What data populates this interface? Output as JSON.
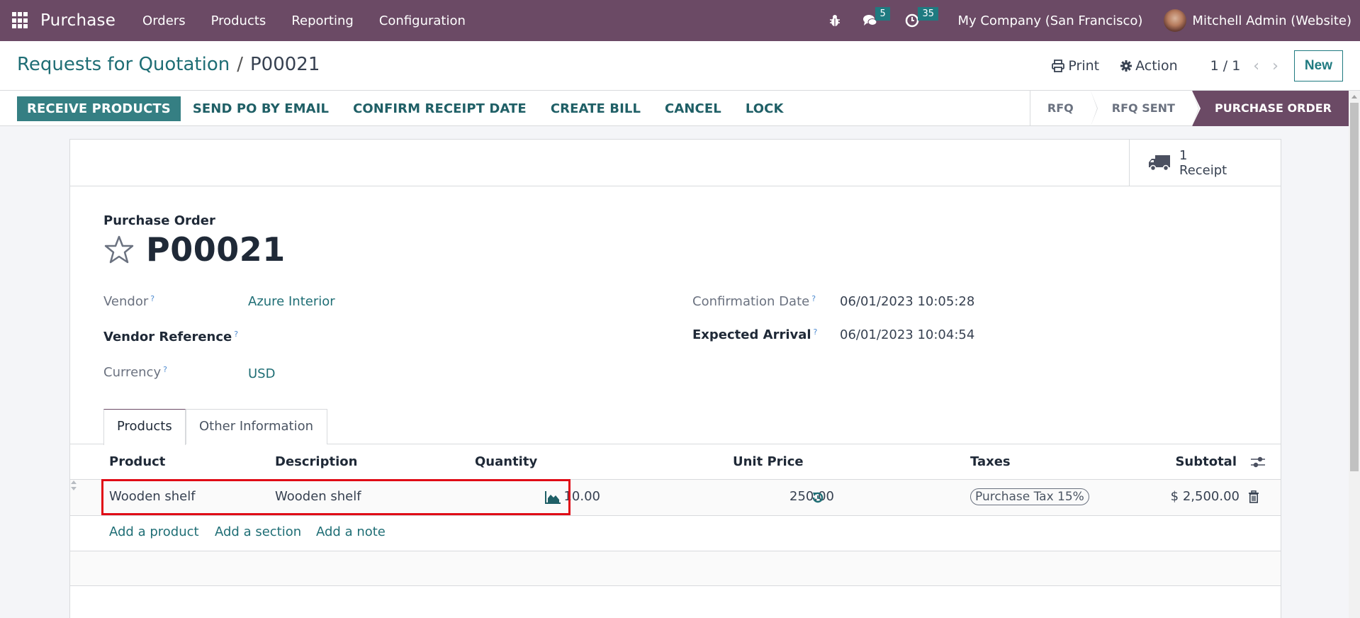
{
  "navbar": {
    "app_name": "Purchase",
    "menu": [
      "Orders",
      "Products",
      "Reporting",
      "Configuration"
    ],
    "messages_count": "5",
    "activities_count": "35",
    "company": "My Company (San Francisco)",
    "user": "Mitchell Admin (Website)",
    "bg_color": "#6b4a65"
  },
  "breadcrumb": {
    "parent": "Requests for Quotation",
    "separator": "/",
    "current": "P00021"
  },
  "control_panel": {
    "print_label": "Print",
    "action_label": "Action",
    "pager": "1 / 1",
    "new_label": "New"
  },
  "statusbar": {
    "actions": [
      "RECEIVE PRODUCTS",
      "SEND PO BY EMAIL",
      "CONFIRM RECEIPT DATE",
      "CREATE BILL",
      "CANCEL",
      "LOCK"
    ],
    "stages": [
      "RFQ",
      "RFQ SENT",
      "PURCHASE ORDER"
    ],
    "active_stage": "PURCHASE ORDER"
  },
  "smart_button": {
    "count": "1",
    "label": "Receipt"
  },
  "form": {
    "title_label": "Purchase Order",
    "record_name": "P00021",
    "help_mark": "?",
    "vendor": {
      "label": "Vendor",
      "value": "Azure Interior"
    },
    "vendor_reference": {
      "label": "Vendor Reference",
      "value": ""
    },
    "currency": {
      "label": "Currency",
      "value": "USD"
    },
    "confirmation_date": {
      "label": "Confirmation Date",
      "value": "06/01/2023 10:05:28"
    },
    "expected_arrival": {
      "label": "Expected Arrival",
      "value": "06/01/2023 10:04:54"
    }
  },
  "tabs": [
    "Products",
    "Other Information"
  ],
  "order_lines": {
    "columns": [
      "Product",
      "Description",
      "Quantity",
      "Unit Price",
      "Taxes",
      "Subtotal"
    ],
    "rows": [
      {
        "product": "Wooden shelf",
        "description": "Wooden shelf",
        "quantity": "10.00",
        "unit_price": "250.00",
        "taxes": "Purchase Tax 15%",
        "subtotal": "$ 2,500.00"
      }
    ],
    "add_links": [
      "Add a product",
      "Add a section",
      "Add a note"
    ]
  },
  "colors": {
    "primary": "#357f83",
    "link": "#1f6e75",
    "highlight": "#e00b16"
  }
}
